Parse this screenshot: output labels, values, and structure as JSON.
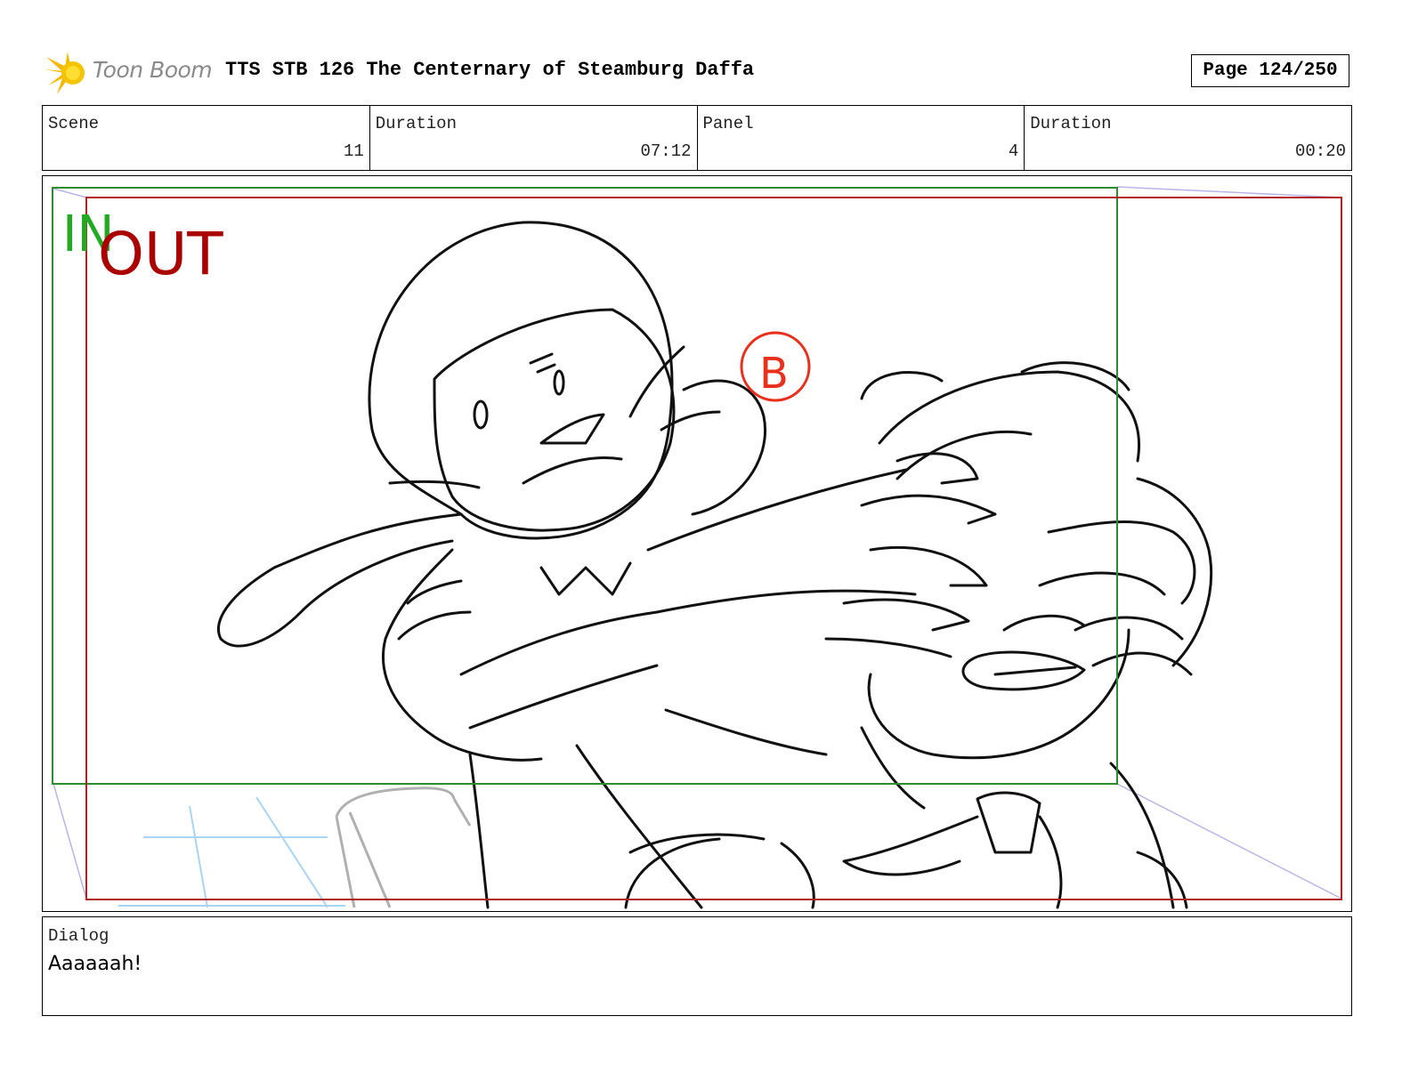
{
  "header": {
    "logo_text": "Toon Boom",
    "title": "TTS STB 126 The Centernary of Steamburg Daffa",
    "page": "Page 124/250"
  },
  "info": [
    {
      "label": "Scene",
      "value": "11"
    },
    {
      "label": "Duration",
      "value": "07:12"
    },
    {
      "label": "Panel",
      "value": "4"
    },
    {
      "label": "Duration",
      "value": "00:20"
    }
  ],
  "panel": {
    "in_label": "IN",
    "out_label": "OUT",
    "in_color": "#22aa22",
    "out_color": "#aa0000",
    "markers": [
      {
        "letter": "B",
        "color": "#e8301c"
      }
    ]
  },
  "dialog": {
    "label": "Dialog",
    "text": "Aaaaaah!"
  }
}
